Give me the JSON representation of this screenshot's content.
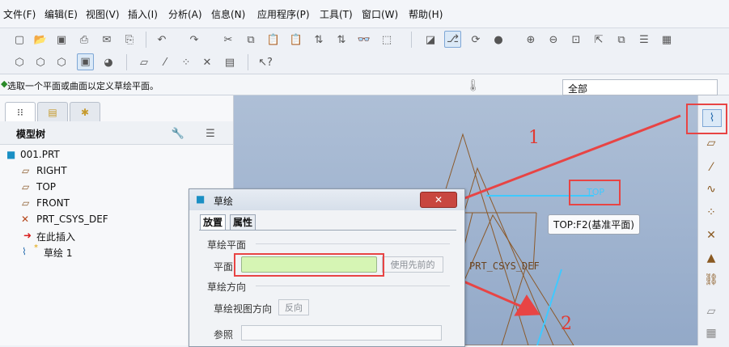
{
  "menu": [
    "文件(F)",
    "编辑(E)",
    "视图(V)",
    "插入(I)",
    "分析(A)",
    "信息(N)",
    "应用程序(P)",
    "工具(T)",
    "窗口(W)",
    "帮助(H)"
  ],
  "status": {
    "message": "选取一个平面或曲面以定义草绘平面。",
    "filter": "全部"
  },
  "model_tree": {
    "title": "模型树",
    "items": [
      "001.PRT",
      "RIGHT",
      "TOP",
      "FRONT",
      "PRT_CSYS_DEF",
      "在此插入",
      "草绘 1"
    ]
  },
  "dialog": {
    "title": "草绘",
    "tabs": [
      "放置",
      "属性"
    ],
    "section_plane": "草绘平面",
    "plane_label": "平面",
    "plane_value": "",
    "use_previous": "使用先前的",
    "section_orientation": "草绘方向",
    "view_direction_label": "草绘视图方向",
    "flip_button": "反向",
    "reference_label": "参照"
  },
  "canvas": {
    "tooltip": "TOP:F2(基准平面)",
    "csys_label": "PRT_CSYS_DEF",
    "annotation_1": "1",
    "annotation_2": "2"
  },
  "colors": {
    "callout": "#e84444",
    "datum": "#8b5a2b",
    "highlight": "#3fc9ff",
    "plane_field": "#d6f5b4"
  }
}
